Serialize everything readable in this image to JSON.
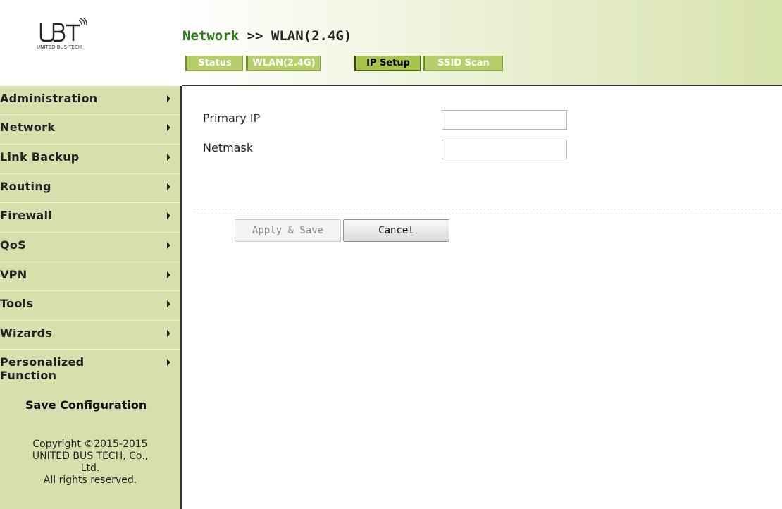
{
  "brand": {
    "logo_text": "UBT",
    "caption": "UNITED BUS TECH"
  },
  "breadcrumb": {
    "category": "Network",
    "separator": ">>",
    "page": "WLAN(2.4G)"
  },
  "tabs": [
    {
      "label": "Status",
      "active": false
    },
    {
      "label": "WLAN(2.4G)",
      "active": false
    },
    {
      "label": "IP Setup",
      "active": true
    },
    {
      "label": "SSID Scan",
      "active": false
    }
  ],
  "sidebar": {
    "items": [
      {
        "label": "Administration"
      },
      {
        "label": "Network"
      },
      {
        "label": "Link Backup"
      },
      {
        "label": "Routing"
      },
      {
        "label": "Firewall"
      },
      {
        "label": "QoS"
      },
      {
        "label": "VPN"
      },
      {
        "label": "Tools"
      },
      {
        "label": "Wizards"
      },
      {
        "label": "Personalized Function"
      }
    ],
    "save_label": "Save Configuration",
    "copyright": [
      "Copyright ©2015-2015",
      "UNITED BUS TECH, Co.,",
      "Ltd.",
      "All rights reserved."
    ]
  },
  "form": {
    "primary_ip_label": "Primary IP",
    "primary_ip_value": "",
    "netmask_label": "Netmask",
    "netmask_value": ""
  },
  "buttons": {
    "apply": "Apply & Save",
    "cancel": "Cancel"
  },
  "colors": {
    "sidebar_bg": "#d5e0ad",
    "tab_bg": "#b7cf6b",
    "tab_active_bg": "#a8c44d",
    "breadcrumb_category": "#2a7a18"
  }
}
